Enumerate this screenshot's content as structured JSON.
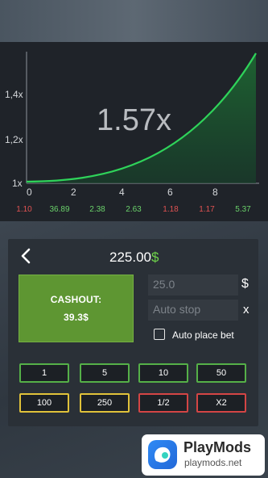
{
  "game": {
    "multiplier": "1.57x",
    "y_ticks": [
      "1,4x",
      "1,2x",
      "1x"
    ],
    "x_ticks": [
      "0",
      "2",
      "4",
      "6",
      "8"
    ],
    "curve_color": "#2fd35a"
  },
  "history": [
    {
      "value": "1.10",
      "color": "red"
    },
    {
      "value": "36.89",
      "color": "green"
    },
    {
      "value": "2.38",
      "color": "green"
    },
    {
      "value": "2.63",
      "color": "green"
    },
    {
      "value": "1.18",
      "color": "red"
    },
    {
      "value": "1.17",
      "color": "red"
    },
    {
      "value": "5.37",
      "color": "green"
    }
  ],
  "bet": {
    "balance": "225.00",
    "currency": "$",
    "cashout_label": "CASHOUT:",
    "cashout_value": "39.3$",
    "amount_value": "25.0",
    "amount_currency": "$",
    "autostop_placeholder": "Auto stop",
    "autostop_clear": "x",
    "autoplace_label": "Auto place bet"
  },
  "chips": [
    {
      "label": "1",
      "color": "green"
    },
    {
      "label": "5",
      "color": "green"
    },
    {
      "label": "10",
      "color": "green"
    },
    {
      "label": "50",
      "color": "green"
    },
    {
      "label": "100",
      "color": "yellow"
    },
    {
      "label": "250",
      "color": "yellow"
    },
    {
      "label": "1/2",
      "color": "red"
    },
    {
      "label": "X2",
      "color": "red"
    }
  ],
  "watermark": {
    "title": "PlayMods",
    "url": "playmods.net"
  }
}
